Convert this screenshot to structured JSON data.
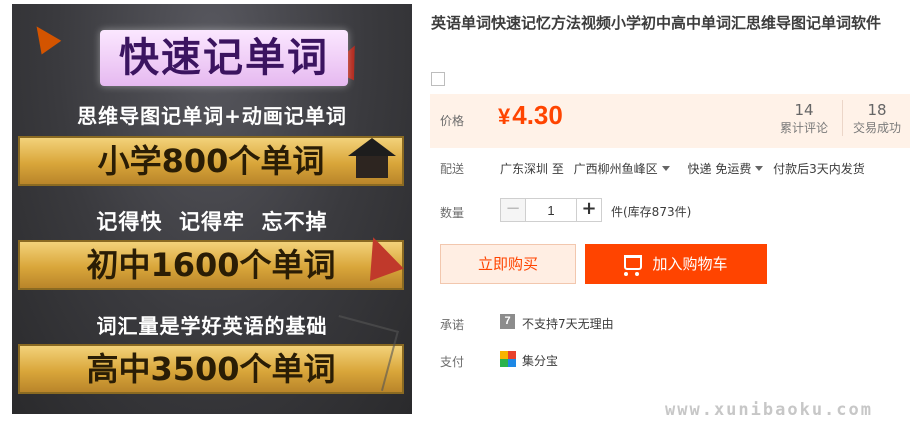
{
  "image": {
    "title": "快速记单词",
    "line1": "思维导图记单词+动画记单词",
    "bar1": "小学800个单词",
    "line2": "记得快  记得牢  忘不掉",
    "bar2": "初中1600个单词",
    "line3": "词汇量是学好英语的基础",
    "bar3": "高中3500个单词"
  },
  "product": {
    "title": "英语单词快速记忆方法视频小学初中高中单词汇思维导图记单词软件"
  },
  "price": {
    "label": "价格",
    "currency": "¥",
    "amount": "4.30",
    "reviews_count": "14",
    "reviews_label": "累计评论",
    "sales_count": "18",
    "sales_label": "交易成功"
  },
  "delivery": {
    "label": "配送",
    "from": "广东深圳 至",
    "to": "广西柳州鱼峰区",
    "method": "快递 免运费",
    "ship_time": "付款后3天内发货"
  },
  "quantity": {
    "label": "数量",
    "value": "1",
    "minus": "−",
    "plus": "+",
    "stock": "件(库存873件)"
  },
  "actions": {
    "buy_now": "立即购买",
    "add_to_cart": "加入购物车"
  },
  "promise": {
    "label": "承诺",
    "icon_text": "7",
    "text": "不支持7天无理由"
  },
  "payment": {
    "label": "支付",
    "text": "集分宝"
  },
  "watermark": "www.xunibaoku.com",
  "colors": {
    "accent": "#ff4400",
    "price_bg": "#fff2e8",
    "buy_now_bg": "#ffeee3"
  }
}
